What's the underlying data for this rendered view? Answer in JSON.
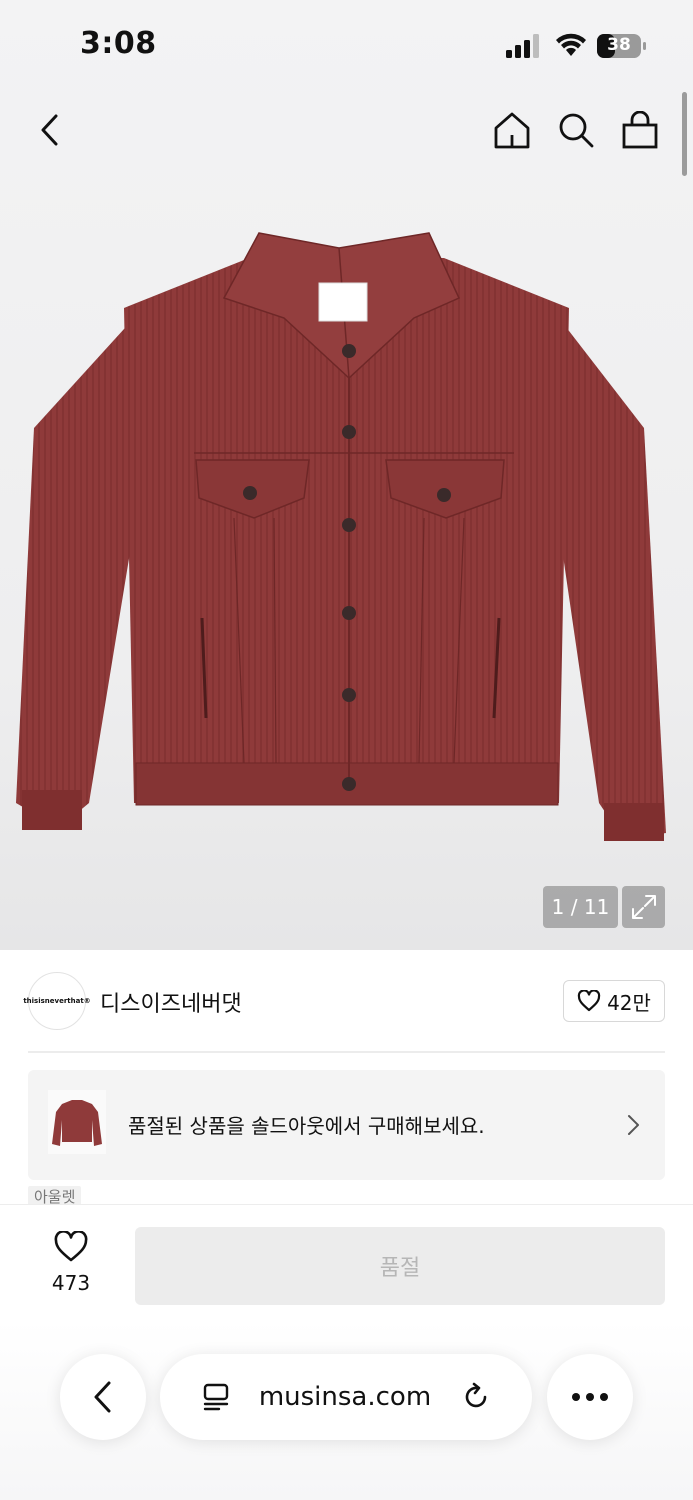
{
  "status_bar": {
    "time": "3:08",
    "battery": "38"
  },
  "nav": {
    "back_icon": "chevron-left-icon",
    "home_icon": "home-icon",
    "search_icon": "search-icon",
    "bag_icon": "shopping-bag-icon"
  },
  "gallery": {
    "counter": "1 / 11",
    "expand_icon": "expand-icon",
    "product_color": "#8f3a3a"
  },
  "brand": {
    "logo_text": "thisisneverthat®",
    "name": "디스이즈네버댓",
    "likes": "42만"
  },
  "soldout_banner": {
    "text": "품절된 상품을 솔드아웃에서 구매해보세요.",
    "tag": "아울렛"
  },
  "purchase_bar": {
    "wish_count": "473",
    "soldout_label": "품절"
  },
  "browser": {
    "url": "musinsa.com"
  }
}
